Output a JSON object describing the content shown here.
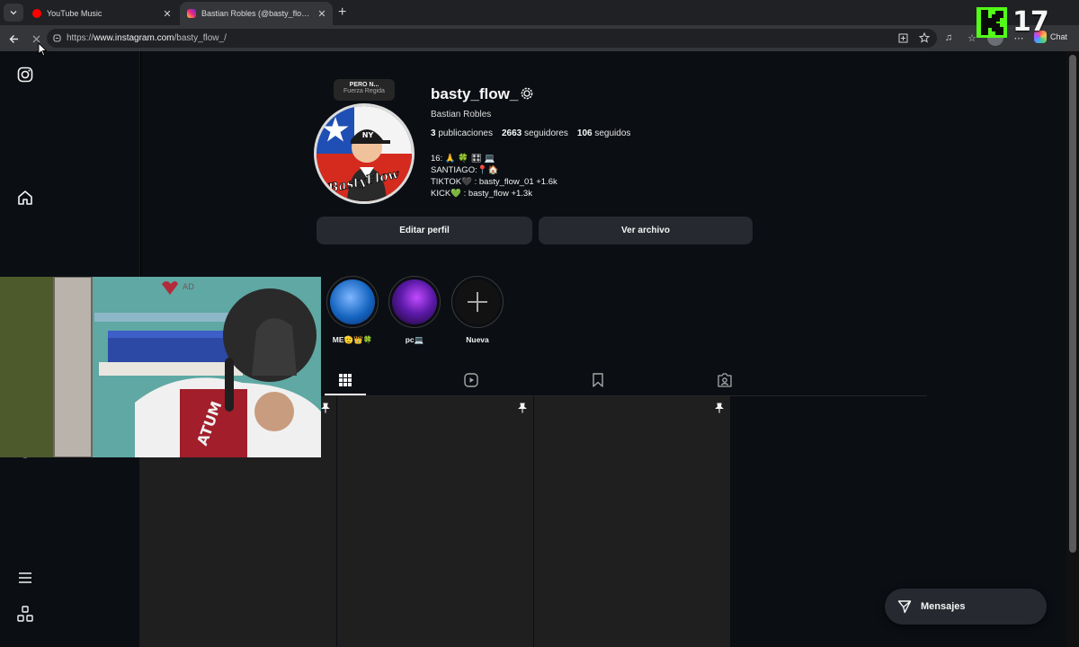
{
  "browser": {
    "tabs": [
      {
        "title": "YouTube Music",
        "favicon_color": "#ff0000"
      },
      {
        "title": "Bastian Robles (@basty_flow_) • Fotos",
        "favicon_color": "#e1306c"
      }
    ],
    "url_prefix": "https://",
    "url_host": "www.instagram.com",
    "url_path": "/basty_flow_/",
    "chat_label": "Chat"
  },
  "stream_overlay": {
    "badge_number": "17",
    "logo": "kick-logo",
    "accent": "#53fc18"
  },
  "profile": {
    "note_title": "PERO N...",
    "note_subtitle": "Fuerza Regida",
    "username": "basty_flow_",
    "full_name": "Bastian Robles",
    "posts_count": "3",
    "posts_label": "publicaciones",
    "followers_count": "2663",
    "followers_label": "seguidores",
    "following_count": "106",
    "following_label": "seguidos",
    "bio_lines": [
      "16: 🙏 🍀 🎛 💻",
      "SANTIAGO:📍🏠",
      "TIKTOK🖤 : basty_flow_01 +1.6k",
      "KICK💚 : basty_flow +1.3k"
    ],
    "edit_button": "Editar perfil",
    "archive_button": "Ver archivo",
    "highlights": [
      {
        "label": "ME🫡👑🍀",
        "color_a": "#1565c0",
        "color_b": "#7fb6ff"
      },
      {
        "label": "pc💻",
        "color_a": "#2a0d5a",
        "color_b": "#c24bff"
      },
      {
        "label": "Nueva",
        "color_a": "#121212",
        "color_b": "#121212"
      }
    ],
    "posts": [
      {
        "pinned": true
      },
      {
        "pinned": true
      },
      {
        "pinned": true
      }
    ]
  },
  "messages_button": "Mensajes",
  "icons": {
    "sidebar": [
      "instagram-icon",
      "home-icon",
      "create-icon",
      "profile-avatar",
      "menu-icon",
      "apps-icon"
    ],
    "profile_tabs": [
      "grid-icon",
      "reels-icon",
      "saved-icon",
      "tagged-icon"
    ]
  }
}
